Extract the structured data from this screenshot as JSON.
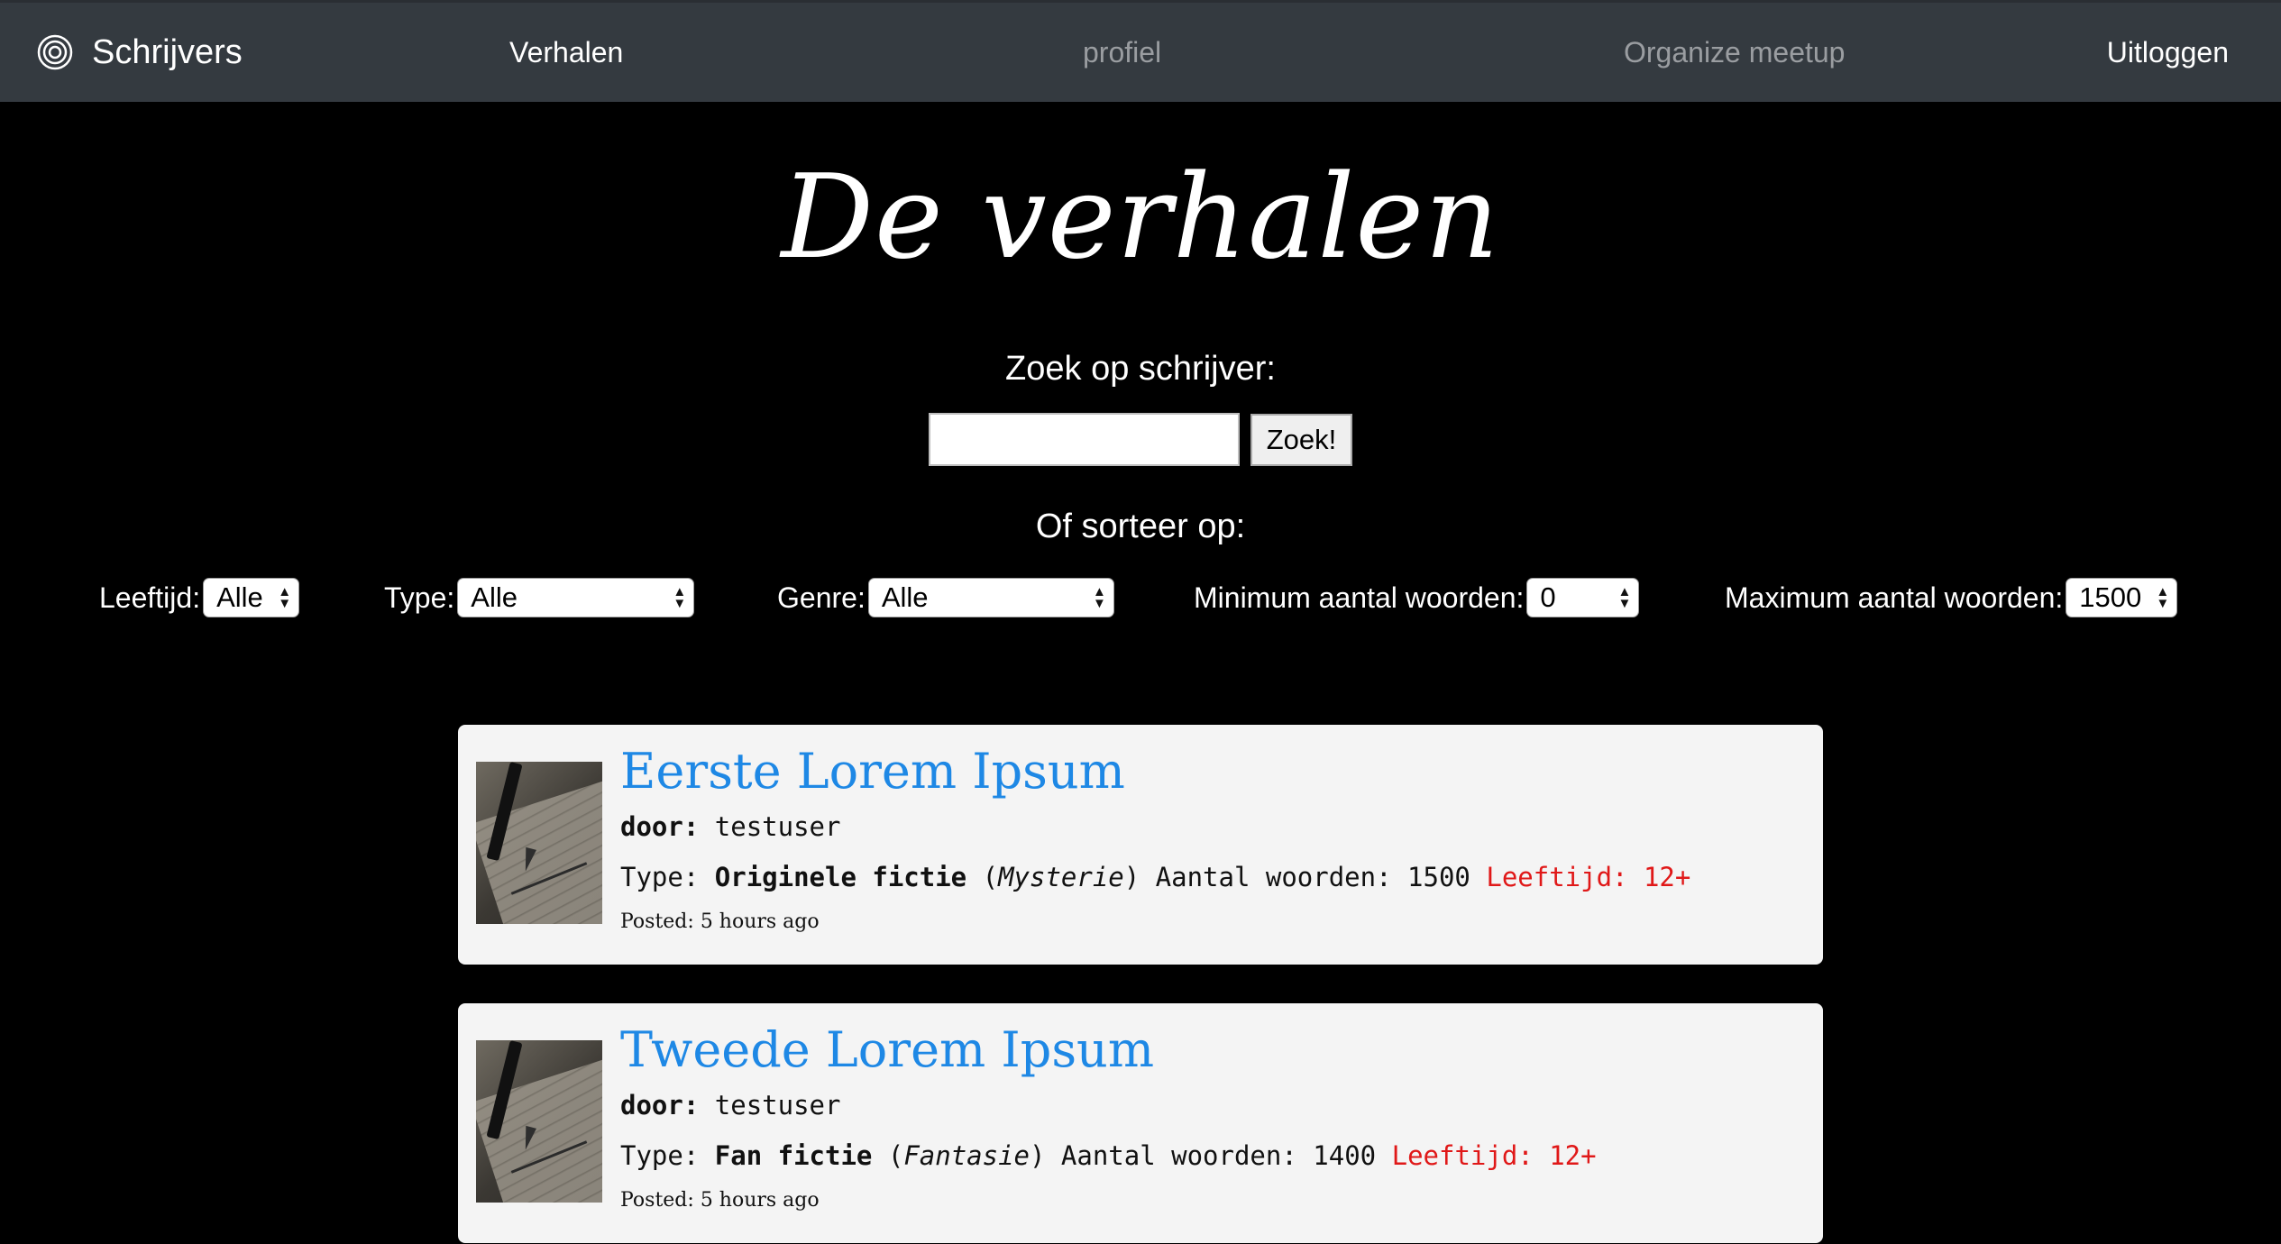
{
  "navbar": {
    "brand": "Schrijvers",
    "brand_icon": "target-icon",
    "links": {
      "stories": "Verhalen",
      "profile": "profiel",
      "meetup": "Organize meetup",
      "logout": "Uitloggen"
    },
    "colors": {
      "background": "#343a40",
      "active": "#ffffff",
      "muted": "#9a9da1"
    }
  },
  "page": {
    "title": "De verhalen",
    "background": "#000000"
  },
  "search": {
    "label": "Zoek op schrijver:",
    "value": "",
    "button": "Zoek!"
  },
  "sort": {
    "label": "Of sorteer op:",
    "filters": {
      "age": {
        "label": "Leeftijd:",
        "value": "Alle"
      },
      "type": {
        "label": "Type:",
        "value": "Alle"
      },
      "genre": {
        "label": "Genre:",
        "value": "Alle"
      },
      "min_words": {
        "label": "Minimum aantal woorden:",
        "value": "0"
      },
      "max_words": {
        "label": "Maximum aantal woorden:",
        "value": "1500"
      }
    }
  },
  "stories": [
    {
      "title": "Eerste Lorem Ipsum",
      "author_label": "door:",
      "author": "testuser",
      "type_label": "Type:",
      "type": "Originele fictie",
      "genre": "Mysterie",
      "words_label": "Aantal woorden:",
      "words": "1500",
      "age_label": "Leeftijd:",
      "age": "12+",
      "posted_label": "Posted:",
      "posted": "5 hours ago"
    },
    {
      "title": "Tweede Lorem Ipsum",
      "author_label": "door:",
      "author": "testuser",
      "type_label": "Type:",
      "type": "Fan fictie",
      "genre": "Fantasie",
      "words_label": "Aantal woorden:",
      "words": "1400",
      "age_label": "Leeftijd:",
      "age": "12+",
      "posted_label": "Posted:",
      "posted": "5 hours ago"
    }
  ],
  "colors": {
    "link": "#1e88e5",
    "age_warning": "#e01818",
    "card_background": "#f4f4f4"
  }
}
